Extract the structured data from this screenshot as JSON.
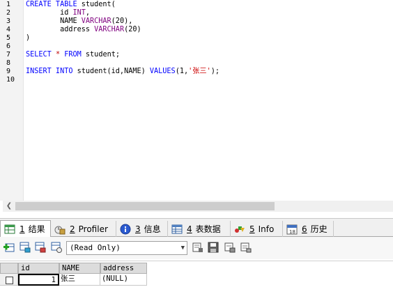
{
  "editor": {
    "line_numbers": [
      "1",
      "2",
      "3",
      "4",
      "5",
      "6",
      "7",
      "8",
      "9",
      "10"
    ],
    "lines": [
      {
        "parts": [
          {
            "t": "CREATE TABLE",
            "c": "kw"
          },
          {
            "t": " student(",
            "c": ""
          }
        ]
      },
      {
        "parts": [
          {
            "t": "        id ",
            "c": ""
          },
          {
            "t": "INT",
            "c": "ty"
          },
          {
            "t": ",",
            "c": ""
          }
        ]
      },
      {
        "parts": [
          {
            "t": "        NAME ",
            "c": ""
          },
          {
            "t": "VARCHAR",
            "c": "ty"
          },
          {
            "t": "(20),",
            "c": ""
          }
        ]
      },
      {
        "parts": [
          {
            "t": "        address ",
            "c": ""
          },
          {
            "t": "VARCHAR",
            "c": "ty"
          },
          {
            "t": "(20)",
            "c": ""
          }
        ]
      },
      {
        "parts": [
          {
            "t": ")",
            "c": ""
          }
        ]
      },
      {
        "parts": []
      },
      {
        "parts": [
          {
            "t": "SELECT",
            "c": "kw"
          },
          {
            "t": " ",
            "c": ""
          },
          {
            "t": "*",
            "c": "op"
          },
          {
            "t": " ",
            "c": ""
          },
          {
            "t": "FROM",
            "c": "kw"
          },
          {
            "t": " student;",
            "c": ""
          }
        ]
      },
      {
        "parts": []
      },
      {
        "parts": [
          {
            "t": "INSERT INTO",
            "c": "kw"
          },
          {
            "t": " student(id,NAME) ",
            "c": ""
          },
          {
            "t": "VALUES",
            "c": "kw"
          },
          {
            "t": "(1,",
            "c": ""
          },
          {
            "t": "'张三'",
            "c": "str"
          },
          {
            "t": ");",
            "c": ""
          }
        ]
      },
      {
        "parts": []
      }
    ]
  },
  "tabs": [
    {
      "num": "1",
      "label": "结果",
      "icon": "results-grid-icon",
      "active": true
    },
    {
      "num": "2",
      "label": "Profiler",
      "icon": "profiler-icon",
      "active": false
    },
    {
      "num": "3",
      "label": "信息",
      "icon": "info-icon",
      "active": false
    },
    {
      "num": "4",
      "label": "表数据",
      "icon": "table-data-icon",
      "active": false
    },
    {
      "num": "5",
      "label": "Info",
      "icon": "shapes-info-icon",
      "active": false
    },
    {
      "num": "6",
      "label": "历史",
      "icon": "calendar-history-icon",
      "active": false
    }
  ],
  "toolbar": {
    "mode_value": "(Read Only)"
  },
  "grid": {
    "columns": [
      "id",
      "NAME",
      "address"
    ],
    "rows": [
      [
        "1",
        "张三",
        "(NULL)"
      ]
    ]
  }
}
